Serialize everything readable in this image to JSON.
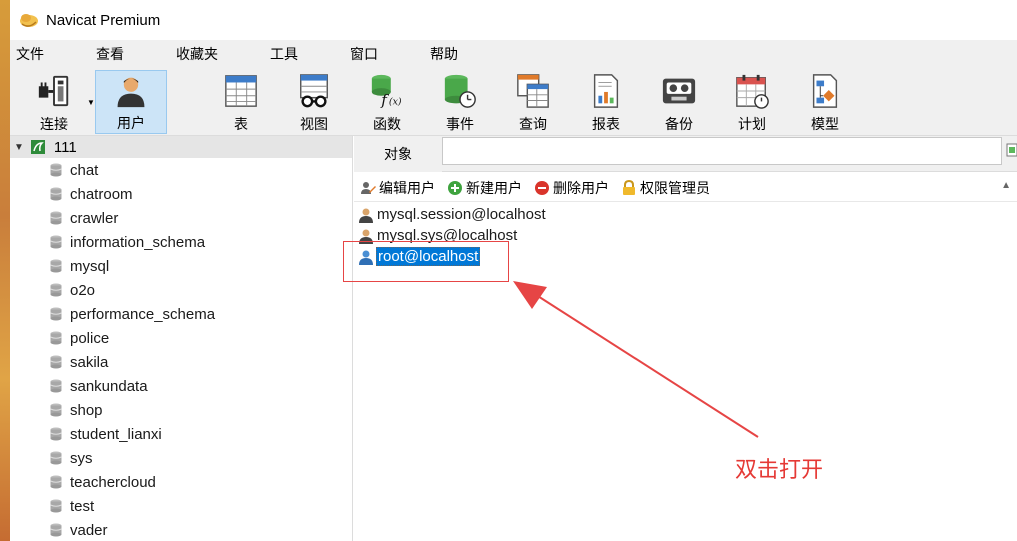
{
  "window": {
    "title": "Navicat Premium"
  },
  "menu": [
    "文件",
    "查看",
    "收藏夹",
    "工具",
    "窗口",
    "帮助"
  ],
  "toolbar": {
    "buttons": [
      {
        "label": "连接",
        "icon": "plug-icon"
      },
      {
        "label": "用户",
        "icon": "user-icon",
        "active": true
      },
      {
        "label": "表",
        "icon": "table-icon"
      },
      {
        "label": "视图",
        "icon": "view-icon"
      },
      {
        "label": "函数",
        "icon": "function-icon"
      },
      {
        "label": "事件",
        "icon": "event-icon"
      },
      {
        "label": "查询",
        "icon": "query-icon"
      },
      {
        "label": "报表",
        "icon": "report-icon"
      },
      {
        "label": "备份",
        "icon": "backup-icon"
      },
      {
        "label": "计划",
        "icon": "calendar-icon"
      },
      {
        "label": "模型",
        "icon": "model-icon"
      }
    ]
  },
  "tree": {
    "root": "111",
    "databases": [
      "chat",
      "chatroom",
      "crawler",
      "information_schema",
      "mysql",
      "o2o",
      "performance_schema",
      "police",
      "sakila",
      "sankundata",
      "shop",
      "student_lianxi",
      "sys",
      "teachercloud",
      "test",
      "vader"
    ]
  },
  "panel": {
    "tab": "对象",
    "actions": [
      "编辑用户",
      "新建用户",
      "删除用户",
      "权限管理员"
    ],
    "users": [
      "mysql.session@localhost",
      "mysql.sys@localhost",
      "root@localhost"
    ],
    "selected_user": "root@localhost"
  },
  "annotation": {
    "text": "双击打开",
    "color": "#e53935"
  },
  "colors": {
    "selection": "#0078d7",
    "active_button": "#cce4f7"
  }
}
